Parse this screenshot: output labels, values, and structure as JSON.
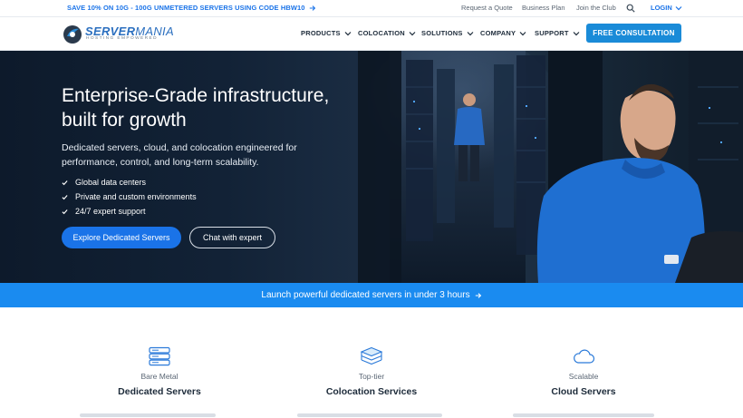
{
  "topbar": {
    "promo": "SAVE 10% ON 10G - 100G UNMETERED SERVERS USING CODE HBW10",
    "links": [
      "Request a Quote",
      "Business Plan",
      "Join the Club"
    ],
    "login": "LOGIN"
  },
  "brand": {
    "name_bold": "SERVER",
    "name_thin": "MANIA",
    "tagline": "HOSTING EMPOWERED"
  },
  "nav": {
    "items": [
      "PRODUCTS",
      "COLOCATION",
      "SOLUTIONS",
      "COMPANY",
      "SUPPORT"
    ],
    "cta": "FREE CONSULTATION"
  },
  "hero": {
    "title": "Enterprise-Grade infrastructure, built for growth",
    "subtitle": "Dedicated servers, cloud, and colocation engineered for performance, control, and long-term scalability.",
    "features": [
      "Global data centers",
      "Private and custom environments",
      "24/7 expert support"
    ],
    "primary_button": "Explore Dedicated Servers",
    "secondary_button": "Chat with expert"
  },
  "banner": {
    "text": "Launch powerful dedicated servers in under 3 hours"
  },
  "services": [
    {
      "icon": "server-stack-icon",
      "eyebrow": "Bare Metal",
      "title": "Dedicated Servers"
    },
    {
      "icon": "colocation-stack-icon",
      "eyebrow": "Top-tier",
      "title": "Colocation Services"
    },
    {
      "icon": "cloud-icon",
      "eyebrow": "Scalable",
      "title": "Cloud Servers"
    }
  ],
  "colors": {
    "accent": "#1a73e8",
    "cta": "#1a8bd8",
    "banner": "#1a8bf0",
    "hero_bg": "#122236",
    "shirt_blue": "#1f6fd1"
  }
}
